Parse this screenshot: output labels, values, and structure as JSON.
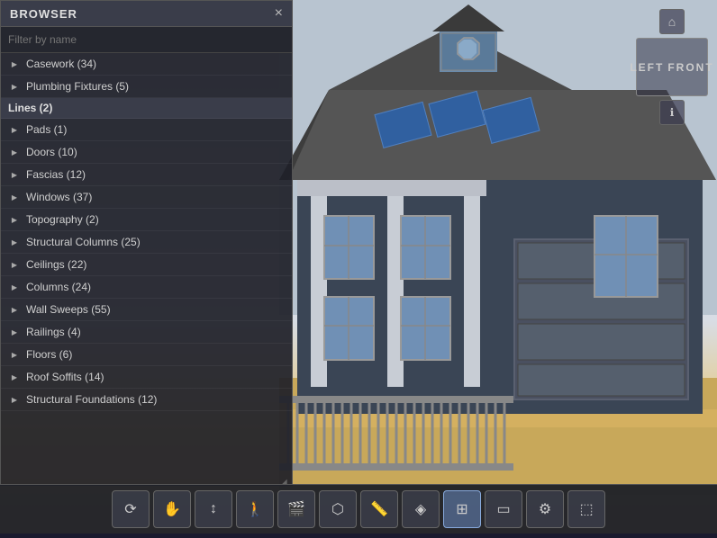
{
  "browser": {
    "title": "BROWSER",
    "search_placeholder": "Filter by name",
    "close_label": "×",
    "items": [
      {
        "label": "Casework (34)",
        "type": "expandable",
        "indent": 0
      },
      {
        "label": "Plumbing Fixtures (5)",
        "type": "expandable",
        "indent": 0
      },
      {
        "label": "Lines (2)",
        "type": "section",
        "indent": 0
      },
      {
        "label": "Pads (1)",
        "type": "expandable",
        "indent": 0
      },
      {
        "label": "Doors (10)",
        "type": "expandable",
        "indent": 0
      },
      {
        "label": "Fascias (12)",
        "type": "expandable",
        "indent": 0
      },
      {
        "label": "Windows (37)",
        "type": "expandable",
        "indent": 0
      },
      {
        "label": "Topography (2)",
        "type": "expandable",
        "indent": 0
      },
      {
        "label": "Structural Columns (25)",
        "type": "expandable",
        "indent": 0
      },
      {
        "label": "Ceilings (22)",
        "type": "expandable",
        "indent": 0
      },
      {
        "label": "Columns (24)",
        "type": "expandable",
        "indent": 0
      },
      {
        "label": "Wall Sweeps (55)",
        "type": "expandable",
        "indent": 0
      },
      {
        "label": "Railings (4)",
        "type": "expandable",
        "indent": 0
      },
      {
        "label": "Floors (6)",
        "type": "expandable",
        "indent": 0
      },
      {
        "label": "Roof Soffits (14)",
        "type": "expandable",
        "indent": 0
      },
      {
        "label": "Structural Foundations (12)",
        "type": "expandable",
        "indent": 0
      }
    ]
  },
  "compass": {
    "left_label": "LEFT",
    "front_label": "FRONT"
  },
  "toolbar": {
    "buttons": [
      {
        "name": "orbit",
        "icon": "⟳",
        "tooltip": "Orbit"
      },
      {
        "name": "pan",
        "icon": "✋",
        "tooltip": "Pan"
      },
      {
        "name": "zoom",
        "icon": "↕",
        "tooltip": "Zoom"
      },
      {
        "name": "walk",
        "icon": "🚶",
        "tooltip": "Walk"
      },
      {
        "name": "camera",
        "icon": "🎥",
        "tooltip": "Camera"
      },
      {
        "name": "cube-view",
        "icon": "⬡",
        "tooltip": "3D View"
      },
      {
        "name": "measure",
        "icon": "📏",
        "tooltip": "Measure"
      },
      {
        "name": "layers",
        "icon": "◈",
        "tooltip": "Layers"
      },
      {
        "name": "plan-view",
        "icon": "⊞",
        "tooltip": "Plan View",
        "active": true
      },
      {
        "name": "section",
        "icon": "▭",
        "tooltip": "Section"
      },
      {
        "name": "settings",
        "icon": "⚙",
        "tooltip": "Settings"
      },
      {
        "name": "share",
        "icon": "⬚",
        "tooltip": "Share"
      }
    ]
  }
}
